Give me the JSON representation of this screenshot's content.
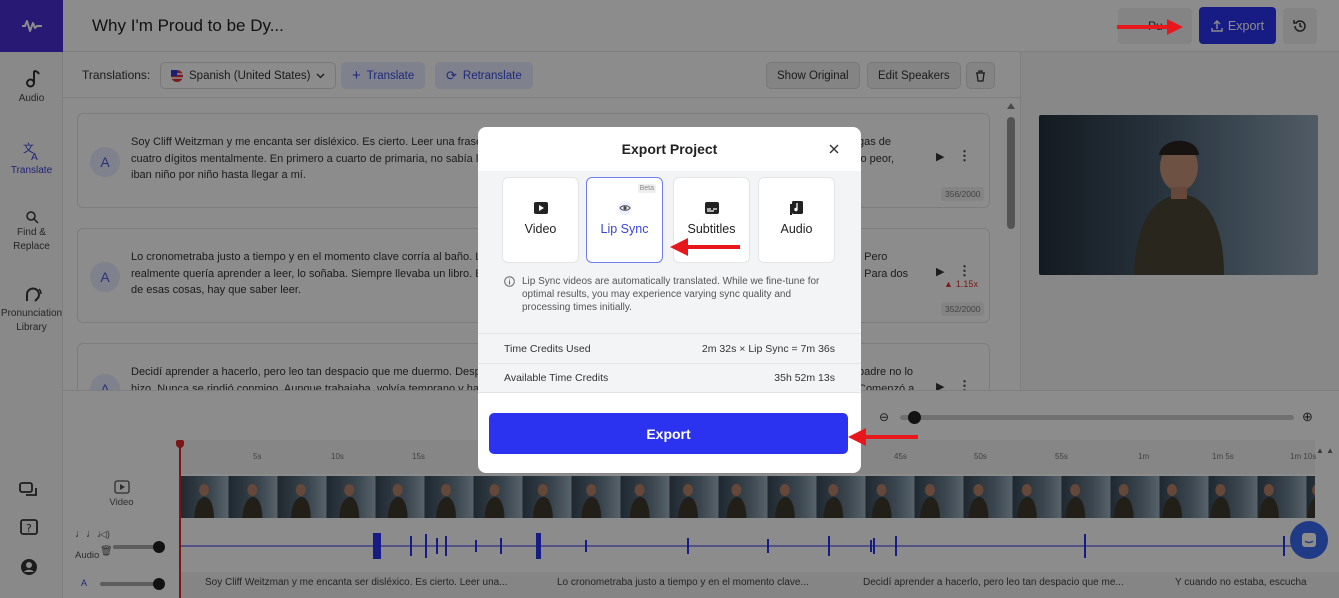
{
  "header": {
    "title": "Why I'm Proud to be Dy...",
    "publish_label": "Pu",
    "export_label": "Export"
  },
  "sidebar": {
    "items": [
      {
        "label": "Audio",
        "icon": "music-note-icon"
      },
      {
        "label": "Translate",
        "icon": "translate-icon"
      },
      {
        "label": "Find & Replace",
        "icon": "search-icon"
      },
      {
        "label": "Pronunciation Library",
        "icon": "speaking-head-icon"
      }
    ]
  },
  "toolbar": {
    "translations_label": "Translations:",
    "language": "Spanish (United States)",
    "translate_label": "Translate",
    "retranslate_label": "Retranslate",
    "show_original_label": "Show Original",
    "edit_speakers_label": "Edit Speakers"
  },
  "segments": [
    {
      "avatar": "A",
      "text_left": "Soy Cliff Weitzman y me encanta ser disléxico. Es cierto. Leer una frase",
      "text_left2": "cuatro dígitos mentalmente. En primero a cuarto de primaria, no sabía l",
      "text_left3": "iban niño por niño hasta llegar a mí.",
      "text_right": "gas de",
      "text_right2": "lo peor,",
      "counter": "356/2000"
    },
    {
      "avatar": "A",
      "text_left": "Lo cronometraba justo a tiempo y en el momento clave corría al baño. L",
      "text_left2": "realmente quería aprender a leer, lo soñaba. Siempre llevaba un libro. E",
      "text_left3": "de esas cosas, hay que saber leer.",
      "text_right": ". Pero",
      "text_right2": ". Para dos",
      "warning": "1.15x",
      "counter": "352/2000"
    },
    {
      "avatar": "A",
      "text_left": "Decidí aprender a hacerlo, pero leo tan despacio que me duermo. Desp",
      "text_left2": "hizo. Nunca se rindió conmigo. Aunque trabajaba, volvía temprano y ha",
      "text_right": "padre no lo",
      "text_right2": "Comenzó a"
    }
  ],
  "timeline": {
    "ticks": [
      "5s",
      "10s",
      "15s",
      "45s",
      "50s",
      "55s",
      "1m",
      "1m 5s",
      "1m 10s"
    ],
    "video_label": "Video",
    "audio_label": "Audio",
    "caption_track_letter": "A",
    "captions": [
      "Soy Cliff Weitzman y me encanta ser disléxico. Es cierto. Leer una...",
      "Lo cronometraba justo a tiempo y en el momento clave...",
      "Decidí aprender a hacerlo, pero leo tan despacio que me...",
      "Y cuando no estaba, escucha"
    ]
  },
  "modal": {
    "title": "Export Project",
    "options": [
      {
        "label": "Video",
        "icon": "play-box-icon"
      },
      {
        "label": "Lip Sync",
        "icon": "eye-icon",
        "badge": "Beta",
        "selected": true
      },
      {
        "label": "Subtitles",
        "icon": "subtitles-icon"
      },
      {
        "label": "Audio",
        "icon": "audio-file-icon"
      }
    ],
    "info": "Lip Sync videos are automatically translated. While we fine-tune for optimal results, you may experience varying sync quality and processing times initially.",
    "rows": [
      {
        "label": "Time Credits Used",
        "value": "2m 32s × Lip Sync = 7m 36s"
      },
      {
        "label": "Available Time Credits",
        "value": "35h 52m 13s"
      }
    ],
    "export_label": "Export"
  },
  "colors": {
    "brand": "#4a2fd6",
    "accent": "#2b33f0",
    "arrow": "#e8171b"
  }
}
